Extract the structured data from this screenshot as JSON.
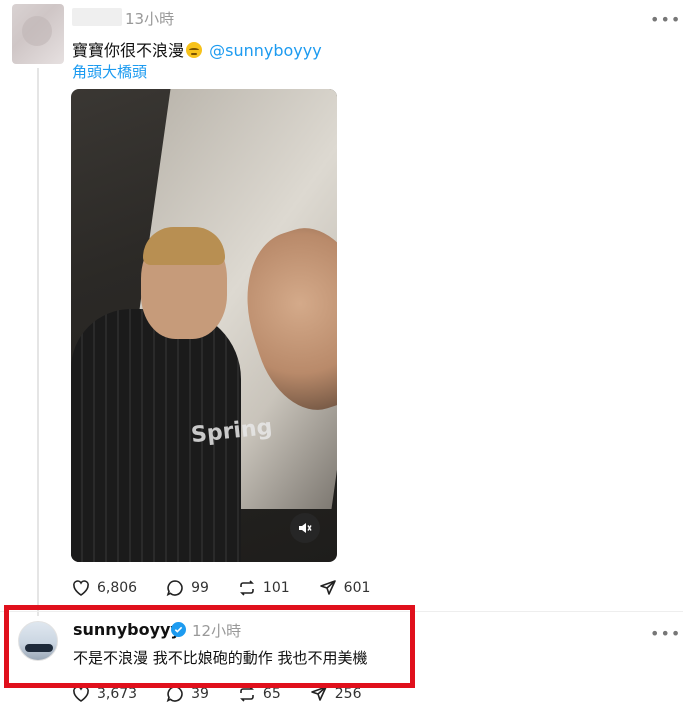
{
  "post1": {
    "time": "13小時",
    "text_before": "寶寶你很不浪漫",
    "mention": "@sunnyboyyy",
    "translation_link": "角頭大橋頭",
    "video": {
      "jersey_text": "Spring"
    },
    "stats": {
      "likes": "6,806",
      "comments": "99",
      "reposts": "101",
      "shares": "601"
    }
  },
  "post2": {
    "username": "sunnyboyyy",
    "time": "12小時",
    "text": "不是不浪漫 我不比娘砲的動作 我也不用美機",
    "stats": {
      "likes": "3,673",
      "comments": "39",
      "reposts": "65",
      "shares": "256"
    }
  },
  "colors": {
    "accent": "#1d9bf0",
    "highlight_box": "#e0101c",
    "muted": "#999999"
  },
  "icons": [
    "more-icon",
    "heart-icon",
    "comment-icon",
    "repost-icon",
    "share-icon",
    "mute-icon",
    "verified-icon",
    "emoji-pensive"
  ]
}
